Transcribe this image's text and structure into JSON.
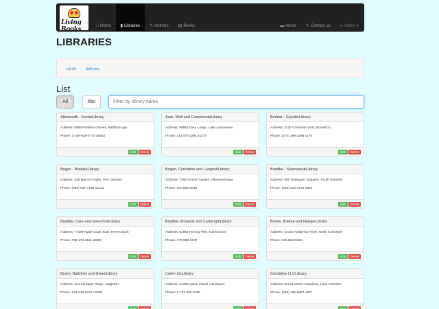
{
  "navbar": {
    "logo_text": "Living Books",
    "items": [
      {
        "icon": "home-icon",
        "glyph": "⌂",
        "label": "Home"
      },
      {
        "icon": "bookmark-icon",
        "glyph": "▮",
        "label": "Libraries"
      },
      {
        "icon": "pencil-icon",
        "glyph": "✎",
        "label": "Authors"
      },
      {
        "icon": "book-icon",
        "glyph": "▤",
        "label": "Books"
      }
    ],
    "right": [
      {
        "icon": "comment-icon",
        "glyph": "▬",
        "label": "About"
      },
      {
        "icon": "pencil-icon",
        "glyph": "✎",
        "label": "Contact us"
      },
      {
        "icon": "user-icon",
        "glyph": "●",
        "label": "Admin ▾"
      }
    ]
  },
  "page": {
    "title": "LIBRARIES"
  },
  "actions": {
    "list_all": "List All",
    "add_new": "Add new"
  },
  "list": {
    "title": "List",
    "filter_all": "All",
    "filter_abc": "Abc",
    "search_placeholder": "Filter by library name"
  },
  "card_labels": {
    "edit": "Edit",
    "delete": "Delete"
  },
  "libraries": [
    {
      "name": "Altenwerth - KundeLibrary",
      "address": "Address: 0886 Pearline Groves, Rathborough",
      "phone": "Phone: 1-168-620-5770 x6543"
    },
    {
      "name": "Auer, Wolf and CummerataLibrary",
      "address": "Address: 96961 Dare Lodge, Lake Leonieview",
      "phone": "Phone: 314.579.2291 x1274"
    },
    {
      "name": "Bednar - GoyetteLibrary",
      "address": "Address: 3130 Consuelo Vista, Emserfort",
      "phone": "Phone: (474) 388-2296 x175"
    },
    {
      "name": "Bogan - BradtkeLibrary",
      "address": "Address: 029 Marco Forges, Port Clement",
      "phone": "Phone: (069) 637-7135 x6113"
    },
    {
      "name": "Bogan, Considine and LangoshLibrary",
      "address": "Address: 7266 Grover Garden, Altenwerthview",
      "phone": "Phone: 457.096.0048"
    },
    {
      "name": "Bradtke - SwaniawskiLibrary",
      "address": "Address: 500 Rodriguez Squares, South Rubyfurt",
      "phone": "Phone: (280) 012-1576 x904"
    },
    {
      "name": "Bradtke, Dare and GreenholtLibrary",
      "address": "Address: 77199 Nyah Court, East Terrenceport",
      "phone": "Phone: 798-178-2111 x8580"
    },
    {
      "name": "Bradtke, Muraziik and CartwrightLibrary",
      "address": "Address: 61964 Herzog Pike, Garrisonton",
      "phone": "Phone: 179-860-8179"
    },
    {
      "name": "Brown, Brekke and HoegerLibrary",
      "address": "Address: 43150 Aufderhar River, North Karinafurt",
      "phone": "Phone: 300.552.9163"
    },
    {
      "name": "Bruen, Balistreri and GreenLibrary",
      "address": "Address: 423 Schuppe Ridge, Judgefort",
      "phone": "Phone: 221-848-5722 x7965"
    },
    {
      "name": "Carter IncLibrary",
      "address": "Address: 41398 Upton Island, Adrianport",
      "phone": "Phone: 1-727-362-0150"
    },
    {
      "name": "Considine LLCLibrary",
      "address": "Address: 52131 Moore Meadows, Lake Faeshire",
      "phone": "Phone: (055) 136-9287 x957"
    }
  ]
}
